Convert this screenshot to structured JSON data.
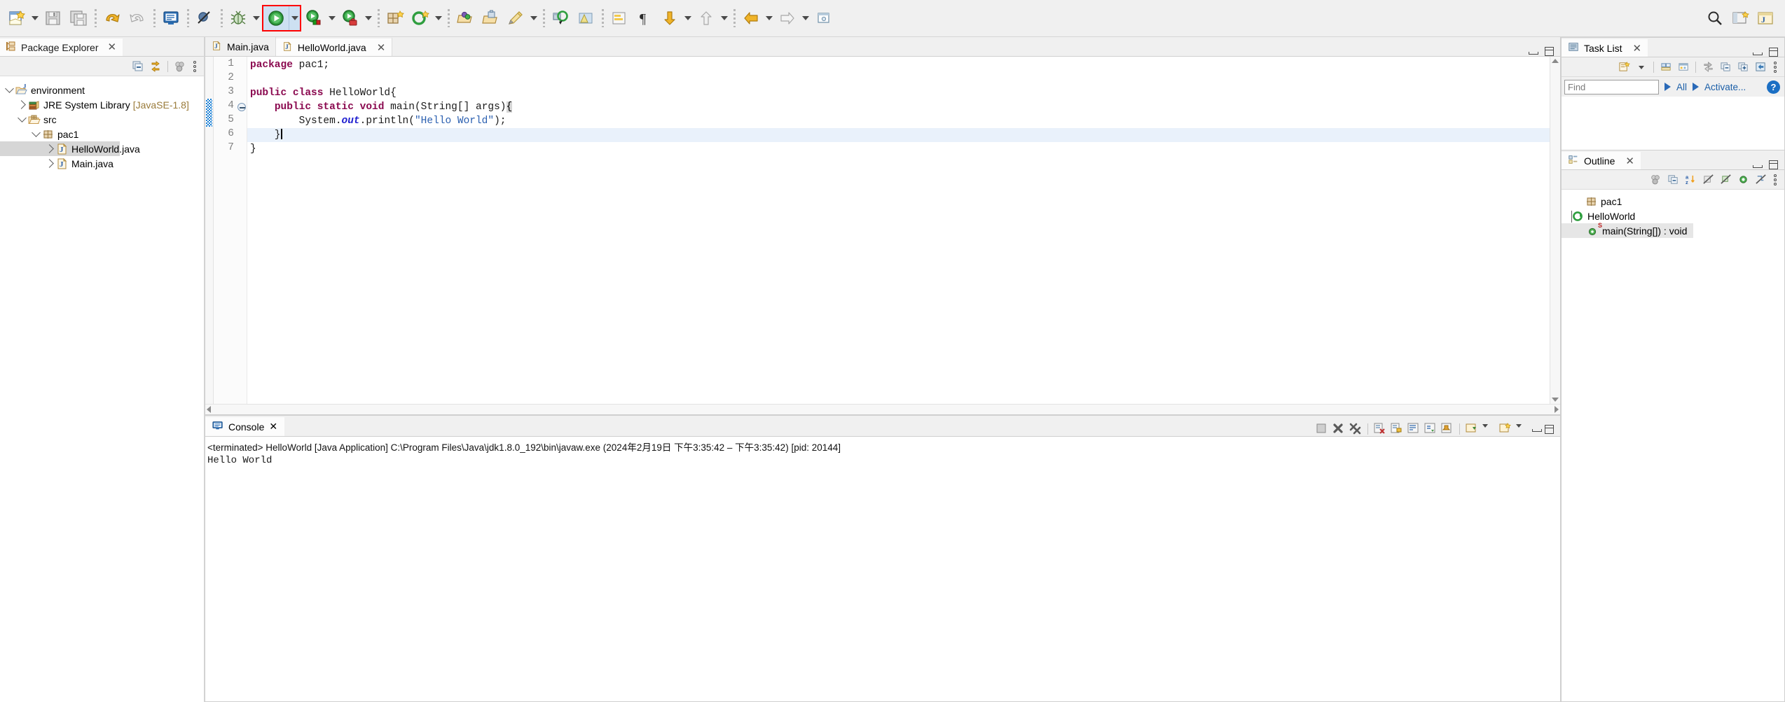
{
  "toolbar": {
    "groups": [
      {
        "items": [
          {
            "name": "new-wizard-button",
            "icon": "new-file-icon",
            "dropdown": true
          },
          {
            "name": "save-button",
            "icon": "save-icon",
            "dropdown": false
          },
          {
            "name": "save-all-button",
            "icon": "save-all-icon",
            "dropdown": false
          }
        ]
      },
      {
        "items": [
          {
            "name": "undo-button",
            "icon": "undo-arrow-icon",
            "dropdown": false
          },
          {
            "name": "redo-button",
            "icon": "redo-arrow-icon",
            "dropdown": false
          }
        ]
      },
      {
        "items": [
          {
            "name": "open-terminal-button",
            "icon": "terminal-monitor-icon",
            "dropdown": false
          }
        ]
      },
      {
        "items": [
          {
            "name": "skip-breakpoints-button",
            "icon": "skip-breakpoints-icon",
            "dropdown": false
          }
        ]
      },
      {
        "items": [
          {
            "name": "debug-button",
            "icon": "bug-icon",
            "dropdown": true
          }
        ]
      },
      {
        "items": [
          {
            "name": "run-button",
            "icon": "run-play-icon",
            "dropdown": true,
            "highlighted": true
          },
          {
            "name": "coverage-button",
            "icon": "run-coverage-icon",
            "dropdown": true
          },
          {
            "name": "external-tools-button",
            "icon": "external-tools-icon",
            "dropdown": true
          }
        ]
      },
      {
        "items": [
          {
            "name": "new-java-package-button",
            "icon": "new-package-icon",
            "dropdown": false
          },
          {
            "name": "new-java-class-button",
            "icon": "new-class-icon",
            "dropdown": true
          }
        ]
      },
      {
        "items": [
          {
            "name": "open-type-button",
            "icon": "open-type-icon",
            "dropdown": false
          },
          {
            "name": "open-task-button",
            "icon": "open-task-icon",
            "dropdown": false
          },
          {
            "name": "annotation-button",
            "icon": "pencil-annotation-icon",
            "dropdown": true
          }
        ]
      },
      {
        "items": [
          {
            "name": "search-references-button",
            "icon": "search-ref-icon",
            "dropdown": false
          },
          {
            "name": "next-annotation-button",
            "icon": "highlight-marker-icon",
            "dropdown": false
          }
        ]
      },
      {
        "items": [
          {
            "name": "toggle-mark-occurrences-button",
            "icon": "mark-occurrences-icon",
            "dropdown": false
          },
          {
            "name": "show-whitespace-button",
            "icon": "pilcrow-icon",
            "dropdown": false
          },
          {
            "name": "next-edit-button",
            "icon": "down-arrow-yellow-icon",
            "dropdown": true
          },
          {
            "name": "previous-edit-button",
            "icon": "up-arrow-grey-icon",
            "dropdown": true
          }
        ]
      },
      {
        "items": [
          {
            "name": "back-history-button",
            "icon": "back-arrow-yellow-icon",
            "dropdown": true
          },
          {
            "name": "forward-history-button",
            "icon": "forward-arrow-grey-icon",
            "dropdown": true
          },
          {
            "name": "pin-editor-button",
            "icon": "pin-editor-icon",
            "dropdown": false
          }
        ]
      }
    ],
    "right_items": [
      {
        "name": "quick-access-search-button",
        "icon": "search-icon"
      },
      {
        "name": "open-perspective-button",
        "icon": "open-perspective-icon"
      },
      {
        "name": "java-perspective-button",
        "icon": "java-perspective-icon"
      }
    ]
  },
  "package_explorer": {
    "tab_label": "Package Explorer",
    "tab_icon": "package-explorer-icon",
    "close_label": "✕",
    "toolbar_buttons": [
      {
        "name": "collapse-all-button",
        "icon": "collapse-all-icon"
      },
      {
        "name": "link-with-editor-button",
        "icon": "link-editor-icon"
      },
      {
        "name": "focus-on-active-task-button",
        "icon": "focus-task-icon"
      },
      {
        "name": "view-menu-button",
        "icon": "view-menu-dots-icon"
      }
    ],
    "tree": [
      {
        "label": "environment",
        "icon": "java-project-icon",
        "indent": 0,
        "expander": "down",
        "selected": false,
        "suffix": ""
      },
      {
        "label": "JRE System Library",
        "icon": "jre-library-icon",
        "indent": 1,
        "expander": "right",
        "selected": false,
        "suffix": "[JavaSE-1.8]"
      },
      {
        "label": "src",
        "icon": "source-folder-icon",
        "indent": 1,
        "expander": "down",
        "selected": false,
        "suffix": ""
      },
      {
        "label": "pac1",
        "icon": "package-icon",
        "indent": 2,
        "expander": "down",
        "selected": false,
        "suffix": ""
      },
      {
        "label": "HelloWorld.java",
        "icon": "java-file-icon",
        "indent": 3,
        "expander": "right",
        "selected": true,
        "suffix": ""
      },
      {
        "label": "Main.java",
        "icon": "java-file-icon",
        "indent": 3,
        "expander": "right",
        "selected": false,
        "suffix": ""
      }
    ]
  },
  "editor": {
    "tabs": [
      {
        "label": "Main.java",
        "icon": "java-file-icon",
        "active": false,
        "closable": false
      },
      {
        "label": "HelloWorld.java",
        "icon": "java-file-icon",
        "active": true,
        "closable": true
      }
    ],
    "close_label": "✕",
    "controls": [
      {
        "name": "minimize-editor-button",
        "icon": "minimize-icon"
      },
      {
        "name": "maximize-editor-button",
        "icon": "maximize-icon"
      }
    ],
    "line_numbers": [
      "1",
      "2",
      "3",
      "4",
      "5",
      "6",
      "7"
    ],
    "highlighted_line": 6,
    "folding_line": 4,
    "lines": [
      {
        "n": 1,
        "tokens": [
          {
            "t": "package",
            "c": "kw"
          },
          {
            "t": " pac1;",
            "c": "plain"
          }
        ]
      },
      {
        "n": 2,
        "tokens": [
          {
            "t": "",
            "c": "plain"
          }
        ]
      },
      {
        "n": 3,
        "tokens": [
          {
            "t": "public class",
            "c": "kw"
          },
          {
            "t": " HelloWorld{",
            "c": "plain"
          }
        ]
      },
      {
        "n": 4,
        "tokens": [
          {
            "t": "    ",
            "c": "plain"
          },
          {
            "t": "public static void",
            "c": "kw"
          },
          {
            "t": " main(",
            "c": "plain"
          },
          {
            "t": "String",
            "c": "plain"
          },
          {
            "t": "[] args)",
            "c": "plain"
          },
          {
            "t": "{",
            "c": "brkt"
          }
        ]
      },
      {
        "n": 5,
        "tokens": [
          {
            "t": "        System.",
            "c": "plain"
          },
          {
            "t": "out",
            "c": "fld"
          },
          {
            "t": ".println(",
            "c": "plain"
          },
          {
            "t": "\"Hello World\"",
            "c": "str"
          },
          {
            "t": ");",
            "c": "plain"
          }
        ]
      },
      {
        "n": 6,
        "tokens": [
          {
            "t": "    }",
            "c": "plain"
          }
        ]
      },
      {
        "n": 7,
        "tokens": [
          {
            "t": "}",
            "c": "plain"
          }
        ]
      }
    ]
  },
  "console": {
    "tab_label": "Console",
    "tab_icon": "console-monitor-icon",
    "close_label": "✕",
    "status_line": "<terminated> HelloWorld [Java Application] C:\\Program Files\\Java\\jdk1.8.0_192\\bin\\javaw.exe  (2024年2月19日 下午3:35:42 – 下午3:35:42) [pid: 20144]",
    "output": "Hello World",
    "toolbar_buttons": [
      {
        "name": "console-terminate-grey-button",
        "icon": "terminate-grey-icon"
      },
      {
        "name": "console-terminate-button",
        "icon": "terminate-red-x-icon"
      },
      {
        "name": "console-remove-all-terminated-button",
        "icon": "remove-all-terminated-icon"
      },
      {
        "name": "console-clear-button",
        "icon": "clear-console-icon"
      },
      {
        "name": "console-scroll-lock-button",
        "icon": "scroll-lock-icon"
      },
      {
        "name": "console-word-wrap-button",
        "icon": "word-wrap-icon"
      },
      {
        "name": "console-show-on-output-button",
        "icon": "show-on-output-icon"
      },
      {
        "name": "console-pin-button",
        "icon": "pin-console-icon"
      },
      {
        "name": "console-display-selected-button",
        "icon": "display-selected-console-icon"
      },
      {
        "name": "console-open-new-button",
        "icon": "new-console-icon"
      },
      {
        "name": "console-minimize-button",
        "icon": "minimize-icon"
      },
      {
        "name": "console-maximize-button",
        "icon": "maximize-icon"
      }
    ]
  },
  "task_list": {
    "tab_label": "Task List",
    "tab_icon": "task-list-icon",
    "close_label": "✕",
    "toolbar_buttons": [
      {
        "name": "new-task-button",
        "icon": "new-task-icon"
      },
      {
        "name": "categorize-button",
        "icon": "categorize-icon"
      },
      {
        "name": "focus-on-workweek-button",
        "icon": "workweek-icon"
      },
      {
        "name": "synchronize-changed-button",
        "icon": "synchronize-icon"
      },
      {
        "name": "collapse-all-tasks-button",
        "icon": "collapse-all-icon"
      },
      {
        "name": "expand-all-tasks-button",
        "icon": "expand-all-icon"
      },
      {
        "name": "restore-tasks-button",
        "icon": "restore-tasks-icon"
      },
      {
        "name": "task-view-menu-button",
        "icon": "view-menu-dots-icon"
      }
    ],
    "find_placeholder": "Find",
    "find_value": "",
    "all_label": "All",
    "activate_label": "Activate...",
    "help_label": "?",
    "controls": [
      {
        "name": "minimize-tasklist-button",
        "icon": "minimize-icon"
      },
      {
        "name": "maximize-tasklist-button",
        "icon": "maximize-icon"
      }
    ]
  },
  "outline": {
    "tab_label": "Outline",
    "tab_icon": "outline-icon",
    "close_label": "✕",
    "toolbar_buttons": [
      {
        "name": "focus-active-task-outline-button",
        "icon": "focus-task-icon"
      },
      {
        "name": "collapse-all-outline-button",
        "icon": "collapse-all-icon"
      },
      {
        "name": "sort-outline-button",
        "icon": "sort-az-icon"
      },
      {
        "name": "hide-fields-button",
        "icon": "hide-fields-icon"
      },
      {
        "name": "hide-static-button",
        "icon": "hide-static-icon"
      },
      {
        "name": "hide-nonpublic-button",
        "icon": "hide-nonpublic-icon"
      },
      {
        "name": "hide-local-types-button",
        "icon": "hide-local-types-icon"
      },
      {
        "name": "outline-view-menu-button",
        "icon": "view-menu-dots-icon"
      }
    ],
    "controls": [
      {
        "name": "minimize-outline-button",
        "icon": "minimize-icon"
      },
      {
        "name": "maximize-outline-button",
        "icon": "maximize-icon"
      }
    ],
    "tree": [
      {
        "label": "pac1",
        "icon": "package-icon",
        "indent": 0,
        "expander": "none",
        "selected": false
      },
      {
        "label": "HelloWorld",
        "icon": "class-icon",
        "indent": 0,
        "expander": "down",
        "selected": false
      },
      {
        "label": "main(String[]) : void",
        "icon": "method-public-icon",
        "indent": 1,
        "expander": "none",
        "selected": true,
        "modifier": "S"
      }
    ]
  },
  "colors": {
    "accent_blue": "#1b6fc4",
    "highlight_red": "#ff0000",
    "selection_blue": "#e9f1fb",
    "keyword": "#8b0a50",
    "string": "#2a5fb0",
    "field": "#2020d0",
    "toolbar_bg": "#f0f0f0"
  }
}
